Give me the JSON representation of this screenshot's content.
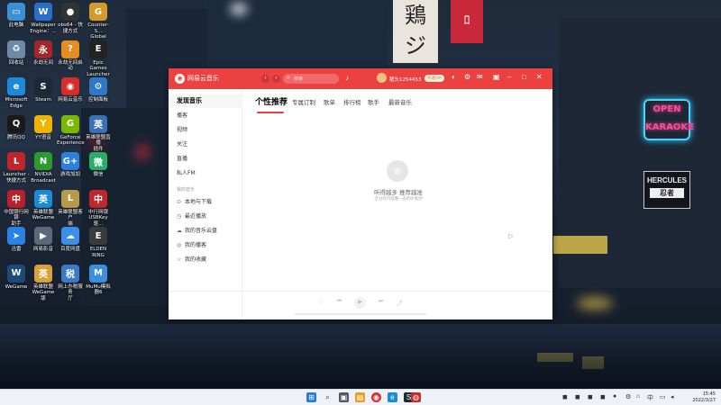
{
  "desktop": {
    "icons": [
      {
        "label": "此电脑",
        "glyph": "▭",
        "color": "#3a8fd6",
        "icon": "computer-icon"
      },
      {
        "label": "Wallpaper\nEngine：...",
        "glyph": "W",
        "color": "#2a6fc9",
        "icon": "wallpaper-engine-icon"
      },
      {
        "label": "obs64 - 快\n捷方式",
        "glyph": "●",
        "color": "#333",
        "icon": "obs-icon"
      },
      {
        "label": "Counter-S...\nGlobal Off...",
        "glyph": "G",
        "color": "#d49a2a",
        "icon": "csgo-icon"
      },
      {
        "label": "回收站",
        "glyph": "♻",
        "color": "#6d8aa8",
        "icon": "recycle-bin-icon"
      },
      {
        "label": "永劫无间",
        "glyph": "永",
        "color": "#a3262a",
        "icon": "naraka-icon"
      },
      {
        "label": "永劫无间启动",
        "glyph": "?",
        "color": "#e58d20",
        "icon": "naraka-launcher-icon"
      },
      {
        "label": "Epic Games\nLauncher",
        "glyph": "E",
        "color": "#222",
        "icon": "epic-games-icon"
      },
      {
        "label": "Microsoft\nEdge",
        "glyph": "e",
        "color": "#1b8adb",
        "icon": "edge-icon"
      },
      {
        "label": "Steam",
        "glyph": "S",
        "color": "#1b2838",
        "icon": "steam-icon"
      },
      {
        "label": "网易云音乐",
        "glyph": "◉",
        "color": "#d62d2d",
        "icon": "netease-music-icon"
      },
      {
        "label": "控制面板",
        "glyph": "⚙",
        "color": "#2e78c7",
        "icon": "control-panel-icon"
      },
      {
        "label": "腾讯QQ",
        "glyph": "Q",
        "color": "#1a1a1a",
        "icon": "qq-icon"
      },
      {
        "label": "YY语音",
        "glyph": "Y",
        "color": "#f0b400",
        "icon": "yy-icon"
      },
      {
        "label": "GeForce\nExperience",
        "glyph": "G",
        "color": "#76b900",
        "icon": "geforce-icon"
      },
      {
        "label": "英雄联盟直播\n插件",
        "glyph": "英",
        "color": "#3b6fb6",
        "icon": "lol-live-icon"
      },
      {
        "label": "Launcher -\n快捷方式",
        "glyph": "L",
        "color": "#c0252a",
        "icon": "launcher-icon"
      },
      {
        "label": "NVIDIA\nBroadcast",
        "glyph": "N",
        "color": "#2c9a2c",
        "icon": "nvidia-broadcast-icon"
      },
      {
        "label": "游戏加加",
        "glyph": "G+",
        "color": "#2a7fe0",
        "icon": "game-plus-icon"
      },
      {
        "label": "微信",
        "glyph": "微",
        "color": "#2aae67",
        "icon": "wechat-icon"
      },
      {
        "label": "中国银行网银\n助手",
        "glyph": "中",
        "color": "#b8212b",
        "icon": "boc-icon"
      },
      {
        "label": "英雄联盟\nWeGame",
        "glyph": "英",
        "color": "#1c8bd6",
        "icon": "lol-wegame-icon"
      },
      {
        "label": "英雄联盟客户\n端",
        "glyph": "L",
        "color": "#b89b4a",
        "icon": "lol-client-icon"
      },
      {
        "label": "中行网银\nUSBKey驱...",
        "glyph": "中",
        "color": "#c0272d",
        "icon": "usbkey-icon"
      },
      {
        "label": "迅雷",
        "glyph": "➤",
        "color": "#2a82e4",
        "icon": "xunlei-icon"
      },
      {
        "label": "网易影音",
        "glyph": "▶",
        "color": "#5a6a7a",
        "icon": "video-player-icon"
      },
      {
        "label": "百度网盘",
        "glyph": "☁",
        "color": "#3d8ee8",
        "icon": "baidu-pan-icon"
      },
      {
        "label": "ELDEN\nRING",
        "glyph": "E",
        "color": "#3a3a3a",
        "icon": "elden-ring-icon"
      },
      {
        "label": "WeGame",
        "glyph": "W",
        "color": "#1e4a7a",
        "icon": "wegame-icon"
      },
      {
        "label": "英雄联盟\nWeGame版",
        "glyph": "英",
        "color": "#d6a23a",
        "icon": "lol-wegame2-icon"
      },
      {
        "label": "网上办税服务\n厅",
        "glyph": "税",
        "color": "#3a7ac9",
        "icon": "tax-icon"
      },
      {
        "label": "MuMu模拟\n器6",
        "glyph": "M",
        "color": "#3b8ee0",
        "icon": "mumu-icon"
      }
    ]
  },
  "app": {
    "name": "网易云音乐",
    "search_placeholder": "搜索",
    "username": "猪头1254453",
    "vip_badge": "开通VIP",
    "sidebar": {
      "items": [
        "发现音乐",
        "播客",
        "视频",
        "关注",
        "直播",
        "私人FM"
      ],
      "section": "我的音乐",
      "my_music": [
        {
          "label": "本地与下载",
          "icon": "download-icon",
          "glyph": "⊙"
        },
        {
          "label": "最近播放",
          "icon": "history-icon",
          "glyph": "◷"
        },
        {
          "label": "我的音乐云盘",
          "icon": "cloud-icon",
          "glyph": "☁"
        },
        {
          "label": "我的播客",
          "icon": "podcast-icon",
          "glyph": "◎"
        },
        {
          "label": "我的收藏",
          "icon": "star-icon",
          "glyph": "☆"
        }
      ]
    },
    "tabs": [
      "个性推荐",
      "专属订制",
      "歌单",
      "排行榜",
      "歌手",
      "最新音乐"
    ],
    "empty": {
      "title": "听得越多 推荐越准",
      "subtitle": "还没有内容喔~去听听看吧"
    }
  },
  "taskbar": {
    "time": "15:45",
    "date": "2022/3/27"
  }
}
